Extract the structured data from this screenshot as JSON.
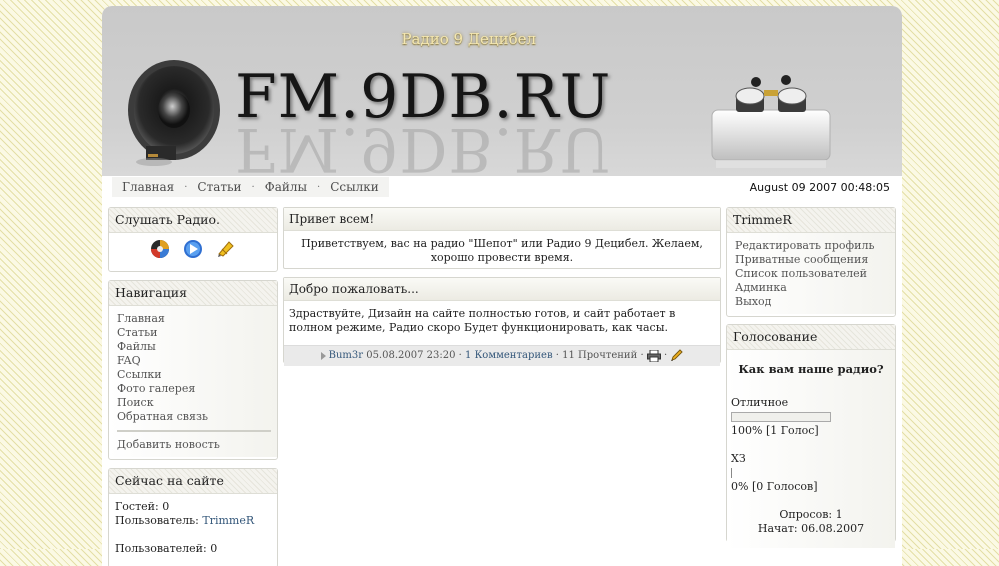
{
  "header": {
    "station_name": "Радио 9 Децибел",
    "logo_text": "FM.9DB.RU"
  },
  "topnav": {
    "items": [
      "Главная",
      "Статьи",
      "Файлы",
      "Ссылки"
    ],
    "separator": "·",
    "datetime": "August 09 2007 00:48:05"
  },
  "left": {
    "listen": {
      "title": "Слушать Радио.",
      "icons": [
        "winamp-icon",
        "media-player-icon",
        "real-player-icon"
      ]
    },
    "nav": {
      "title": "Навигация",
      "items": [
        "Главная",
        "Статьи",
        "Файлы",
        "FAQ",
        "Ссылки",
        "Фото галерея",
        "Поиск",
        "Обратная связь"
      ],
      "add_news": "Добавить новость"
    },
    "online": {
      "title": "Сейчас на сайте",
      "guests": "Гостей: 0",
      "user_label": "Пользователь: ",
      "user_name": "TrimmeR",
      "users": "Пользователей: 0"
    }
  },
  "center": {
    "welcome": {
      "title": "Привет всем!",
      "text": "Приветствуем, вас на радио \"Шепот\" или Радио 9 Децибел. Желаем, хорошо провести время."
    },
    "news": {
      "title": "Добро пожаловать...",
      "text": "Здраствуйте, Дизайн на сайте полностью готов, и сайт работает в полном режиме, Радио скоро Будет функционировать, как часы.",
      "author": "Bum3r",
      "date": "05.08.2007 23:20",
      "comments": "1 Комментариев",
      "reads": "11 Прочтений",
      "sep": "·"
    }
  },
  "right": {
    "user": {
      "title": "TrimmeR",
      "links": [
        "Редактировать профиль",
        "Приватные сообщения",
        "Список пользователей",
        "Админка",
        "Выход"
      ]
    },
    "poll": {
      "title": "Голосование",
      "question": "Как вам наше радио?",
      "options": [
        {
          "label": "Отличное",
          "percent": 100,
          "result": "100% [1 Голос]"
        },
        {
          "label": "ХЗ",
          "percent": 0,
          "result": "0% [0 Голосов]"
        }
      ],
      "total": "Опросов: 1",
      "started": "Начат: 06.08.2007"
    }
  }
}
